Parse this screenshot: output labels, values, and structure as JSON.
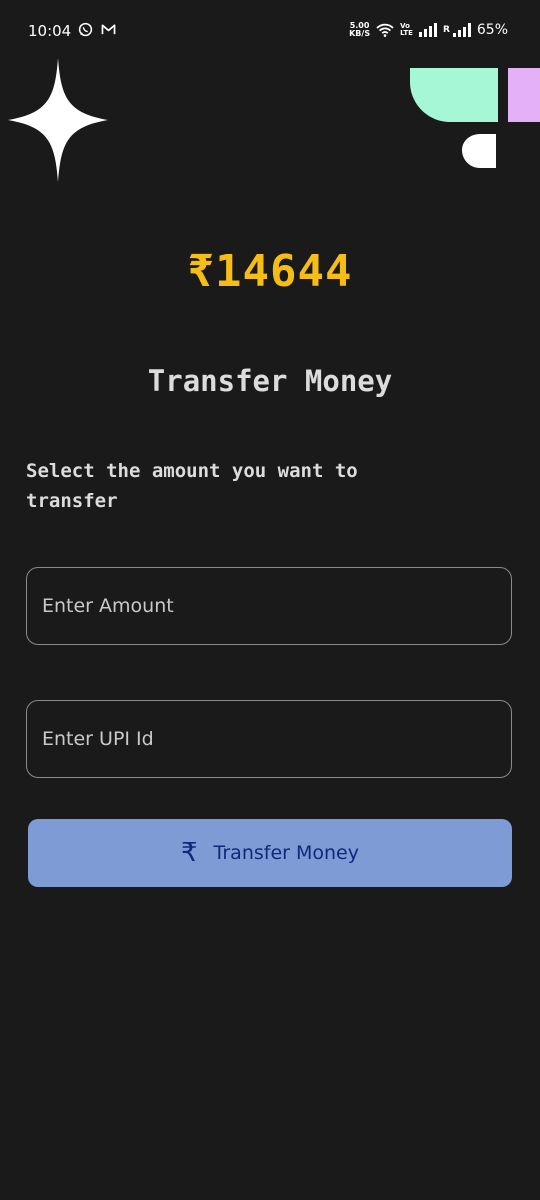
{
  "status_bar": {
    "time": "10:04",
    "speed_value": "5.00",
    "speed_unit": "KB/S",
    "volte_top": "Vo",
    "volte_bottom": "LTE",
    "roaming": "R",
    "battery": "65%",
    "icons": [
      "whatsapp-icon",
      "gmail-icon",
      "wifi-icon",
      "signal-icon",
      "signal-roaming-icon"
    ]
  },
  "wallet": {
    "balance": "₹14644"
  },
  "page": {
    "title": "Transfer Money",
    "subtitle": "Select the amount you want to transfer"
  },
  "form": {
    "amount_placeholder": "Enter Amount",
    "upi_placeholder": "Enter UPI Id",
    "submit_label": "Transfer Money",
    "submit_icon": "rupee-icon"
  },
  "colors": {
    "background": "#1a1a1a",
    "balance": "#f6bd16",
    "button": "#7f9bd6",
    "button_text": "#0e2a78",
    "deco_mint": "#a6f7d6",
    "deco_lilac": "#e4b0f7"
  }
}
